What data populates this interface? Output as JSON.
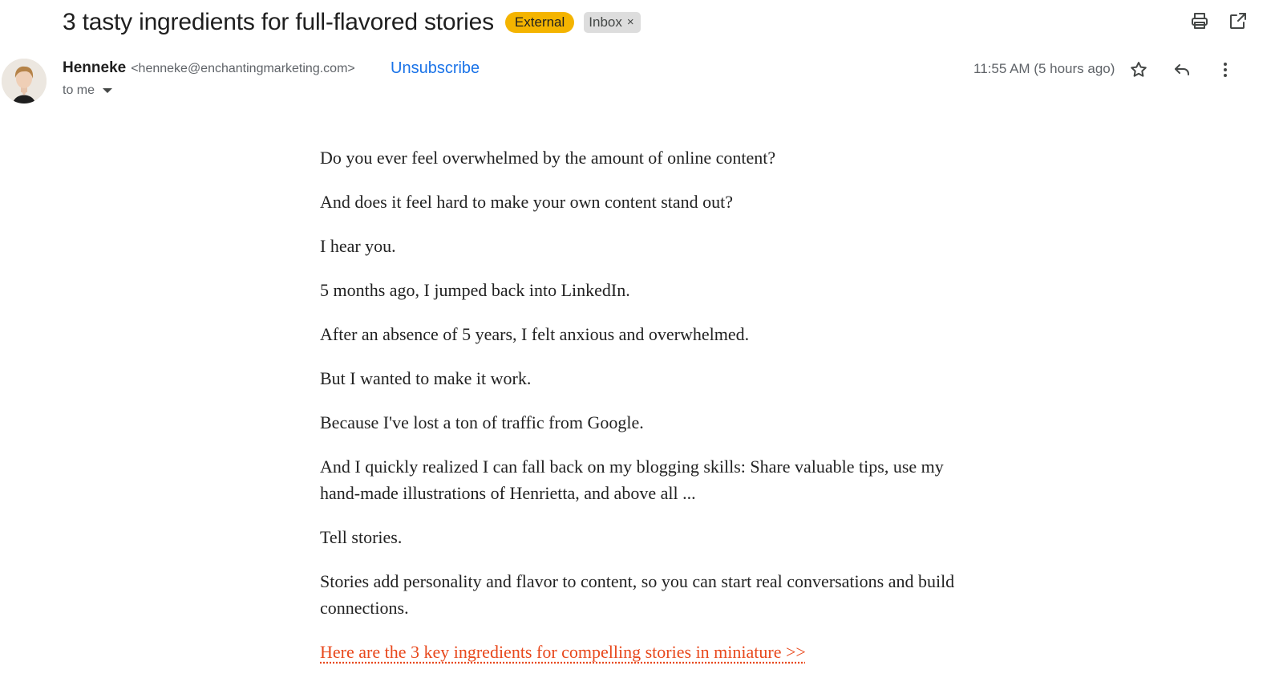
{
  "header": {
    "subject": "3 tasty ingredients for full-flavored stories",
    "badges": {
      "external": "External",
      "inbox": "Inbox",
      "inbox_remove": "×"
    },
    "icons": {
      "print": "printer-icon",
      "popout": "open-in-new-window-icon"
    }
  },
  "message": {
    "sender_name": "Henneke",
    "sender_email": "<henneke@enchantingmarketing.com>",
    "unsubscribe": "Unsubscribe",
    "recipient": "to me",
    "timestamp": "11:55 AM (5 hours ago)",
    "icons": {
      "star": "star-icon",
      "reply": "reply-icon",
      "more": "more-vertical-icon"
    }
  },
  "body": {
    "paragraphs": [
      "Do you ever feel overwhelmed by the amount of online content?",
      "And does it feel hard to make your own content stand out?",
      "I hear you.",
      "5 months ago, I jumped back into LinkedIn.",
      "After an absence of 5 years, I felt anxious and overwhelmed.",
      "But I wanted to make it work.",
      "Because I've lost a ton of traffic from Google.",
      "And I quickly realized I can fall back on my blogging skills: Share valuable tips, use my hand-made illustrations of Henrietta, and above all ...",
      "Tell stories.",
      "Stories add personality and flavor to content, so you can start real conversations and build connections."
    ],
    "link": "Here are the 3 key ingredients for compelling stories in miniature >>"
  },
  "colors": {
    "external_badge": "#f4b400",
    "link": "#e8481c",
    "unsubscribe": "#1a73e8"
  }
}
